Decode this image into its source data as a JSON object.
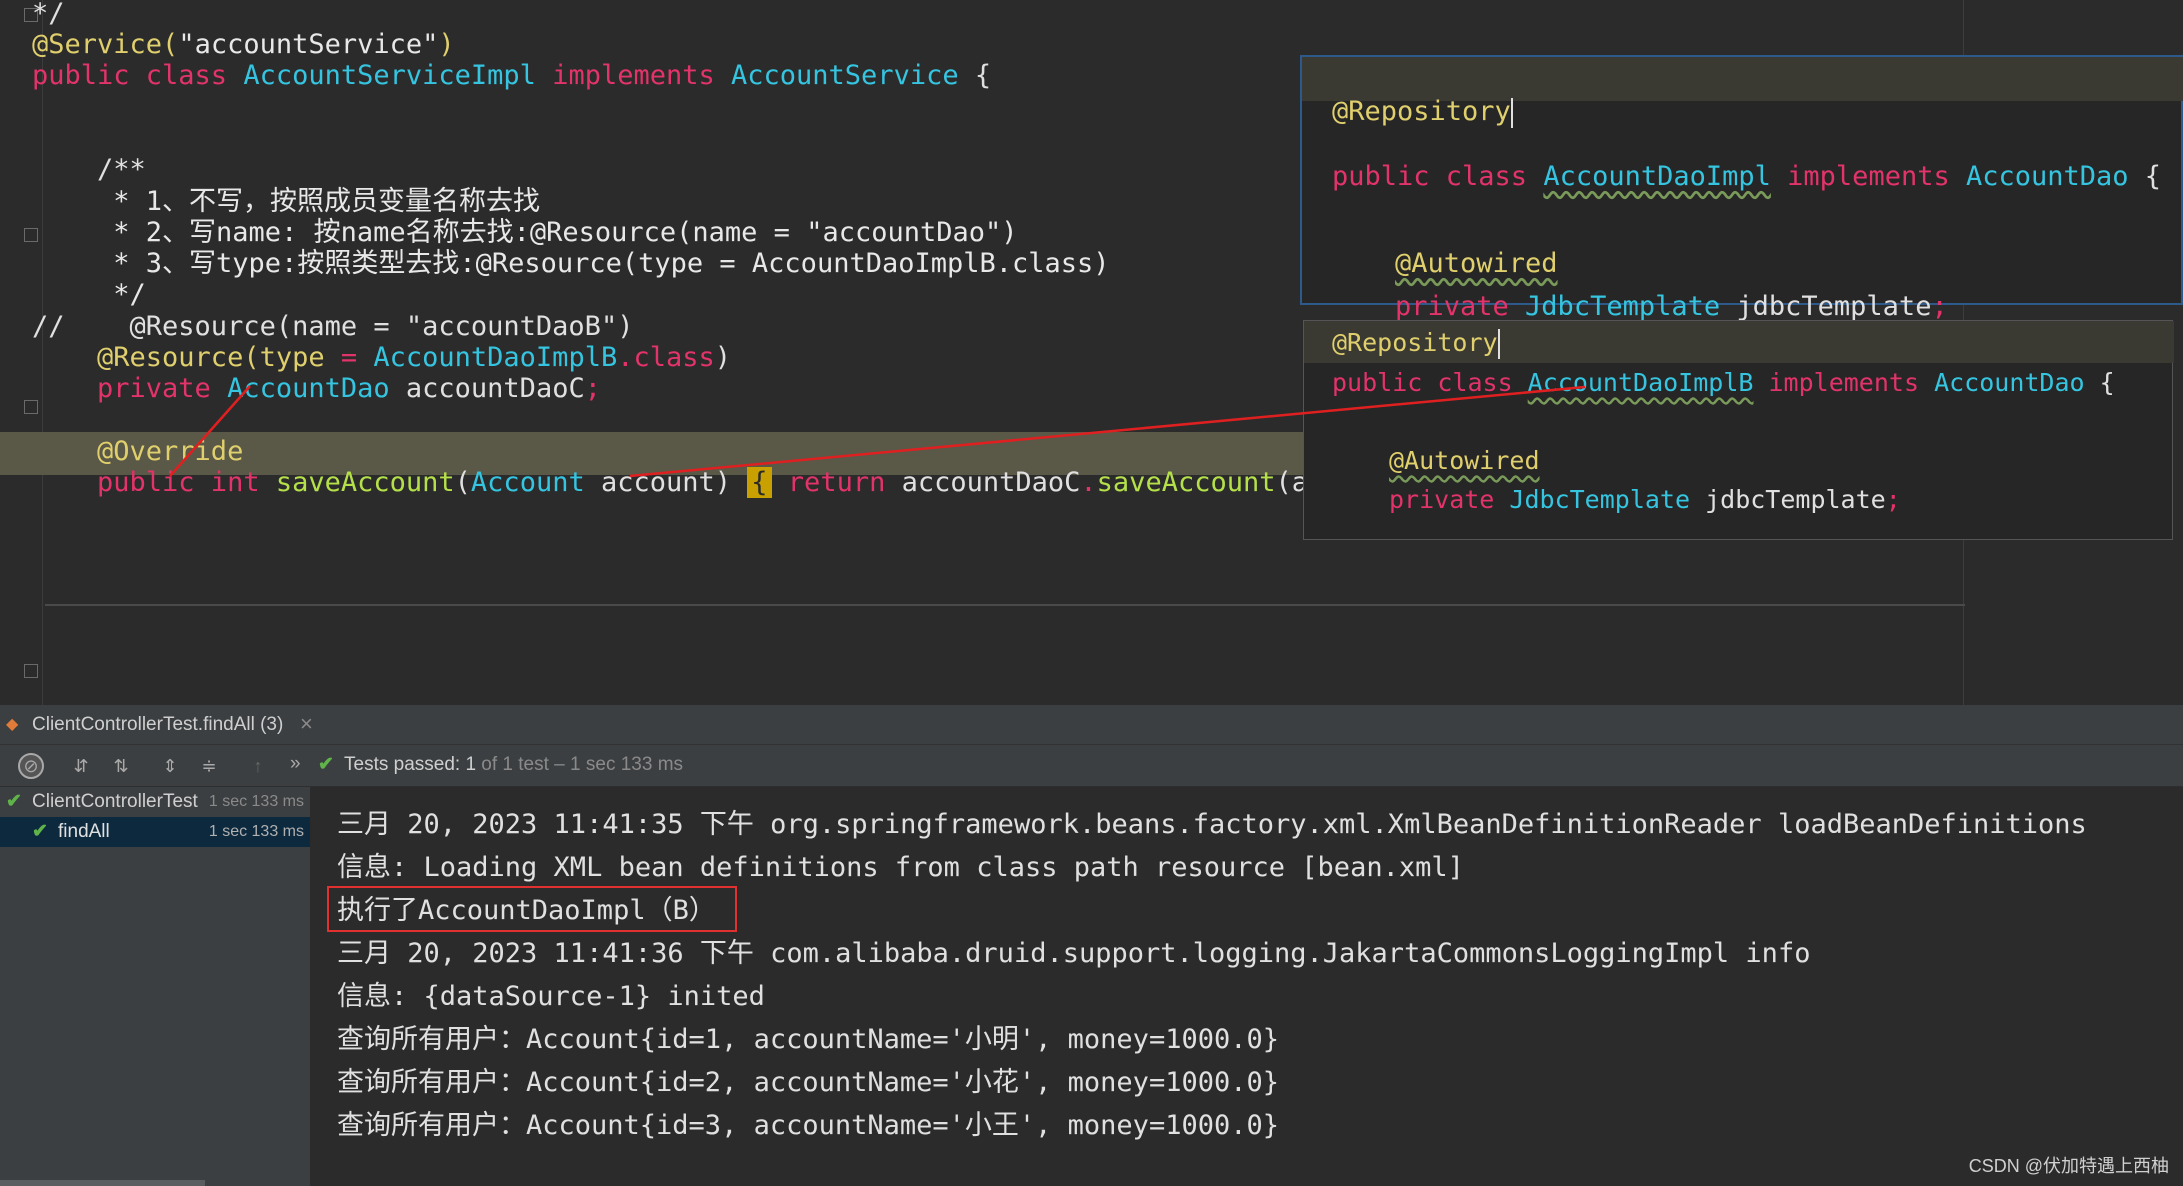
{
  "editor": {
    "lines": [
      {
        "parts": [
          {
            "c": "pl",
            "t": "*/"
          }
        ]
      },
      {
        "parts": [
          {
            "c": "an",
            "t": "@Service("
          },
          {
            "c": "st",
            "t": "\"accountService\""
          },
          {
            "c": "an",
            "t": ")"
          }
        ]
      },
      {
        "parts": [
          {
            "c": "kw",
            "t": "public class "
          },
          {
            "c": "ty",
            "t": "AccountServiceImpl"
          },
          {
            "c": "kw",
            "t": " implements "
          },
          {
            "c": "ty",
            "t": "AccountService"
          },
          {
            "c": "pl",
            "t": " {"
          }
        ]
      },
      {
        "parts": [
          {
            "c": "pl",
            "t": ""
          }
        ]
      },
      {
        "parts": [
          {
            "c": "pl",
            "t": "    /**"
          }
        ]
      },
      {
        "parts": [
          {
            "c": "cm",
            "t": "     * 1、不写，按照成员变量名称去找"
          }
        ]
      },
      {
        "parts": [
          {
            "c": "cm",
            "t": "     * 2、写name: 按name名称去找:@Resource(name = \"accountDao\")"
          }
        ]
      },
      {
        "parts": [
          {
            "c": "cm",
            "t": "     * 3、写type:按照类型去找:@Resource(type = AccountDaoImplB.class)"
          }
        ]
      },
      {
        "parts": [
          {
            "c": "cm",
            "t": "     */"
          }
        ]
      },
      {
        "parts": [
          {
            "c": "pl",
            "t": "//    @Resource(name = \"accountDaoB\")"
          }
        ]
      },
      {
        "parts": [
          {
            "c": "an",
            "t": "    @Resource(type "
          },
          {
            "c": "kw",
            "t": "= "
          },
          {
            "c": "ty",
            "t": "AccountDaoImplB"
          },
          {
            "c": "kw",
            "t": ".class"
          },
          {
            "c": "pl",
            "t": ")"
          }
        ]
      },
      {
        "parts": [
          {
            "c": "kw",
            "t": "    private "
          },
          {
            "c": "ty",
            "t": "AccountDao"
          },
          {
            "c": "pl",
            "t": " accountDaoC"
          },
          {
            "c": "kw",
            "t": ";"
          }
        ]
      },
      {
        "parts": [
          {
            "c": "pl",
            "t": ""
          }
        ]
      },
      {
        "parts": [
          {
            "c": "an",
            "t": "    @Override"
          }
        ]
      },
      {
        "parts": [
          {
            "c": "kw",
            "t": "    public int "
          },
          {
            "c": "fn",
            "t": "saveAccount"
          },
          {
            "c": "pl",
            "t": "("
          },
          {
            "c": "ty",
            "t": "Account"
          },
          {
            "c": "pl",
            "t": " account) "
          },
          {
            "c": "brace",
            "t": "{"
          },
          {
            "c": "kw",
            "t": " return "
          },
          {
            "c": "pl",
            "t": "accountDaoC"
          },
          {
            "c": "kw",
            "t": "."
          },
          {
            "c": "fn",
            "t": "saveAccount"
          },
          {
            "c": "pl",
            "t": "(account)"
          },
          {
            "c": "kw",
            "t": "; "
          },
          {
            "c": "brace",
            "t": "}"
          }
        ]
      }
    ]
  },
  "popup1": {
    "annotation": "@Repository",
    "l1": [
      {
        "c": "kw",
        "t": "public class "
      },
      {
        "c": "ty sq",
        "t": "AccountDaoImpl"
      },
      {
        "c": "kw",
        "t": " implements "
      },
      {
        "c": "ty",
        "t": "AccountDao"
      },
      {
        "c": "pl",
        "t": " {"
      }
    ],
    "l2": [
      {
        "c": "an sq",
        "t": "@Autowired"
      }
    ],
    "l3": [
      {
        "c": "kw",
        "t": "private "
      },
      {
        "c": "ty",
        "t": "JdbcTemplate"
      },
      {
        "c": "pl",
        "t": " jdbcTemplate"
      },
      {
        "c": "kw",
        "t": ";"
      }
    ]
  },
  "popup2": {
    "annotation": "@Repository",
    "l1": [
      {
        "c": "kw",
        "t": "public class "
      },
      {
        "c": "ty sq",
        "t": "AccountDaoImplB"
      },
      {
        "c": "kw",
        "t": " implements "
      },
      {
        "c": "ty",
        "t": "AccountDao"
      },
      {
        "c": "pl",
        "t": " {"
      }
    ],
    "l2": [
      {
        "c": "an sq",
        "t": "@Autowired"
      }
    ],
    "l3": [
      {
        "c": "kw",
        "t": "private "
      },
      {
        "c": "ty",
        "t": "JdbcTemplate"
      },
      {
        "c": "pl",
        "t": " jdbcTemplate"
      },
      {
        "c": "kw",
        "t": ";"
      }
    ]
  },
  "run_tab": {
    "label": "ClientControllerTest.findAll (3)",
    "close": "×"
  },
  "toolbar": {
    "status_prefix": "Tests passed: ",
    "status_count": "1",
    "status_rest": " of 1 test – 1 sec 133 ms",
    "more": "»"
  },
  "tree": [
    {
      "label": "ClientControllerTest",
      "time": "1 sec 133 ms",
      "selected": false
    },
    {
      "label": "findAll",
      "time": "1 sec 133 ms",
      "selected": true
    }
  ],
  "console": [
    "三月 20, 2023 11:41:35 下午 org.springframework.beans.factory.xml.XmlBeanDefinitionReader loadBeanDefinitions",
    "信息: Loading XML bean definitions from class path resource [bean.xml]",
    "执行了AccountDaoImpl（B）",
    "三月 20, 2023 11:41:36 下午 com.alibaba.druid.support.logging.JakartaCommonsLoggingImpl info",
    "信息: {dataSource-1} inited",
    "查询所有用户：Account{id=1, accountName='小明', money=1000.0}",
    "查询所有用户：Account{id=2, accountName='小花', money=1000.0}",
    "查询所有用户：Account{id=3, accountName='小王', money=1000.0}"
  ],
  "watermark": "CSDN @伏加特遇上西柚",
  "colors": {
    "highlight_box": "#e03030",
    "arrow": "#e02020",
    "passed": "#5fb34a"
  }
}
